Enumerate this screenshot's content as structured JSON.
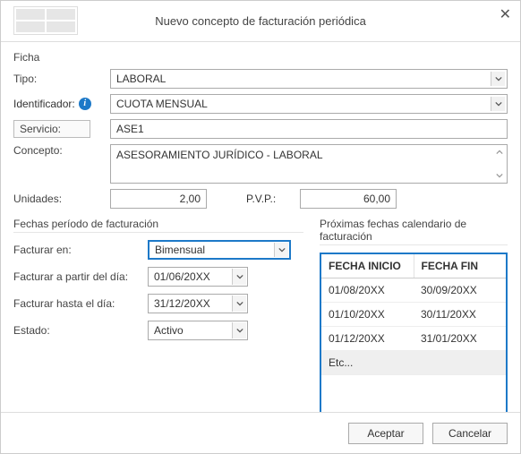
{
  "titlebar": {
    "title": "Nuevo concepto de facturación periódica"
  },
  "ficha": {
    "section": "Ficha",
    "tipo_label": "Tipo:",
    "tipo_value": "LABORAL",
    "ident_label": "Identificador:",
    "ident_value": "CUOTA MENSUAL",
    "servicio_label": "Servicio:",
    "servicio_value": "ASE1",
    "concepto_label": "Concepto:",
    "concepto_value": "ASESORAMIENTO JURÍDICO - LABORAL",
    "unidades_label": "Unidades:",
    "unidades_value": "2,00",
    "pvp_label": "P.V.P.:",
    "pvp_value": "60,00"
  },
  "periodo": {
    "section": "Fechas período de facturación",
    "facturar_en_label": "Facturar en:",
    "facturar_en_value": "Bimensual",
    "desde_label": "Facturar a partir del día:",
    "desde_value": "01/06/20XX",
    "hasta_label": "Facturar hasta el día:",
    "hasta_value": "31/12/20XX",
    "estado_label": "Estado:",
    "estado_value": "Activo"
  },
  "calendario": {
    "section": "Próximas fechas calendario de facturación",
    "col_inicio": "FECHA INICIO",
    "col_fin": "FECHA FIN",
    "rows": [
      {
        "inicio": "01/08/20XX",
        "fin": "30/09/20XX"
      },
      {
        "inicio": "01/10/20XX",
        "fin": "30/11/20XX"
      },
      {
        "inicio": "01/12/20XX",
        "fin": "31/01/20XX"
      }
    ],
    "etc": "Etc..."
  },
  "footer": {
    "ok": "Aceptar",
    "cancel": "Cancelar"
  }
}
